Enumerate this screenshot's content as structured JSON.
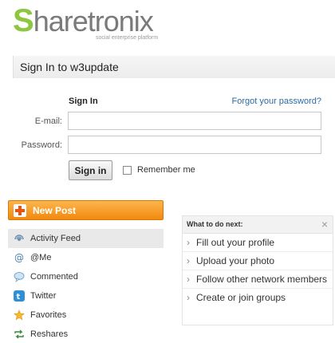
{
  "logo": {
    "brand_s": "S",
    "brand_rest": "haretronix",
    "tagline": "social enterprise platform"
  },
  "page_title": "Sign In to w3update",
  "signin": {
    "heading": "Sign In",
    "forgot_link": "Forgot your password?",
    "email_label": "E-mail:",
    "email_value": "",
    "password_label": "Password:",
    "password_value": "",
    "submit_label": "Sign in",
    "remember_label": "Remember me",
    "remember_checked": false
  },
  "new_post": {
    "label": "New Post",
    "icon": "plus-icon",
    "color": "#f39a1f"
  },
  "nav": {
    "items": [
      {
        "label": "Activity Feed",
        "icon": "activity-feed-icon",
        "active": true
      },
      {
        "label": "@Me",
        "icon": "at-icon",
        "active": false
      },
      {
        "label": "Commented",
        "icon": "comment-icon",
        "active": false
      },
      {
        "label": "Twitter",
        "icon": "twitter-icon",
        "active": false
      },
      {
        "label": "Favorites",
        "icon": "star-icon",
        "active": false
      },
      {
        "label": "Reshares",
        "icon": "reshare-icon",
        "active": false
      }
    ]
  },
  "next_panel": {
    "title": "What to do next:",
    "close": "×",
    "items": [
      {
        "label": "Fill out your profile"
      },
      {
        "label": "Upload your photo"
      },
      {
        "label": "Follow other network members"
      },
      {
        "label": "Create or join groups"
      }
    ]
  },
  "colors": {
    "brand_green": "#8dc63f",
    "brand_gray": "#7a7a7a",
    "link_blue": "#2c6aa3",
    "orange": "#f39a1f"
  }
}
